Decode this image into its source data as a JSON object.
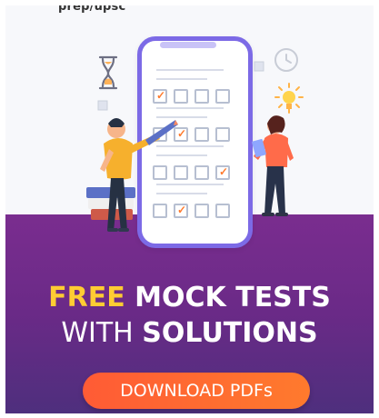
{
  "header": {
    "text": "prep/upsc"
  },
  "headline": {
    "line1_accent": "FREE",
    "line1_rest": " MOCK TESTS",
    "line2_light": "WITH ",
    "line2_strong": "SOLUTIONS"
  },
  "cta": {
    "label": "DOWNLOAD PDFs"
  },
  "icons": {
    "hourglass": "hourglass-icon",
    "clock": "clock-icon",
    "bulb": "lightbulb-icon",
    "checkbox_small_1": "checkbox-icon",
    "checkbox_small_2": "checkbox-icon"
  },
  "colors": {
    "purple_start": "#7a2d8f",
    "purple_end": "#4e2f7d",
    "accent_yellow": "#ffcc33",
    "cta_orange": "#ff6a2f",
    "phone_border": "#7c6ae6"
  }
}
